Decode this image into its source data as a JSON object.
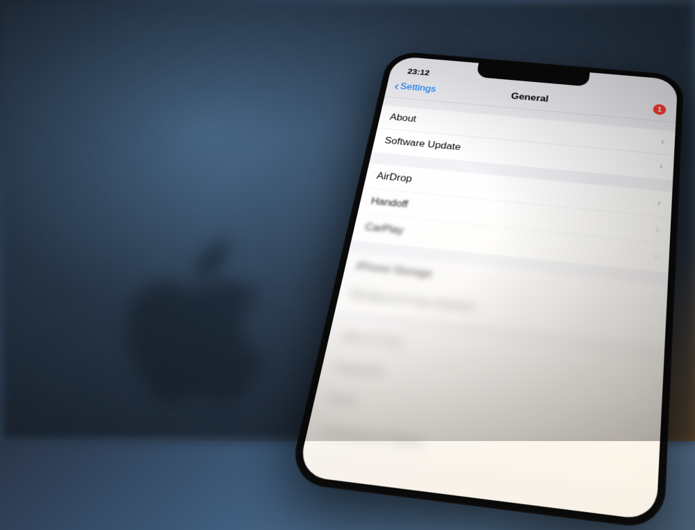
{
  "statusBar": {
    "time": "23:12"
  },
  "navBar": {
    "backLabel": "Settings",
    "title": "General",
    "badgeCount": "1"
  },
  "groups": [
    {
      "rows": [
        {
          "label": "About"
        },
        {
          "label": "Software Update"
        }
      ]
    },
    {
      "rows": [
        {
          "label": "AirDrop"
        },
        {
          "label": "Handoff"
        },
        {
          "label": "CarPlay"
        }
      ]
    },
    {
      "rows": [
        {
          "label": "iPhone Storage"
        },
        {
          "label": "Background App Refresh"
        }
      ]
    },
    {
      "rows": [
        {
          "label": "Date & Time"
        },
        {
          "label": "Keyboard"
        },
        {
          "label": "Fonts"
        },
        {
          "label": "Language & Region"
        }
      ]
    }
  ],
  "colors": {
    "accent": "#007aff",
    "badge": "#ff3b30",
    "background": "#f2f2f7",
    "rowBackground": "#ffffff"
  }
}
